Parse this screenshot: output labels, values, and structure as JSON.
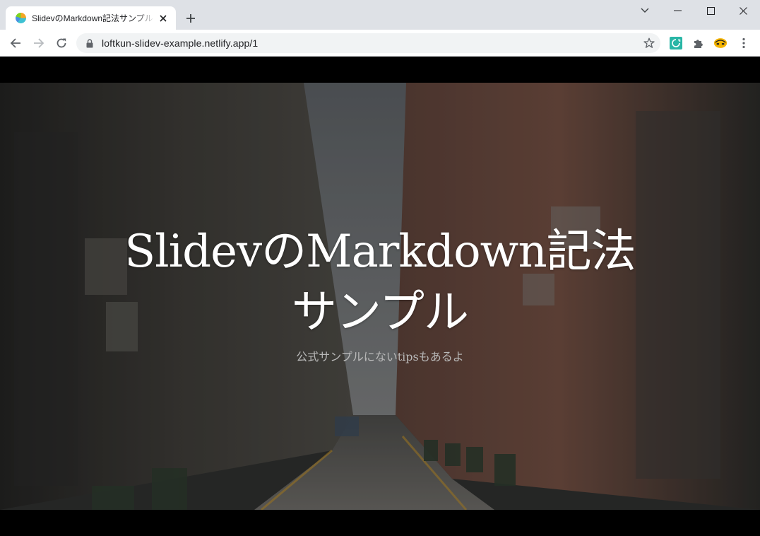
{
  "browser": {
    "tab": {
      "title": "SlidevのMarkdown記法サンプル - Slidev"
    },
    "address": {
      "url": "loftkun-slidev-example.netlify.app/1"
    }
  },
  "slide": {
    "title_line1": "SlidevのMarkdown記法",
    "title_line2": "サンプル",
    "subtitle": "公式サンプルにないtipsもあるよ"
  },
  "icons": {
    "tab": [
      "favicon",
      "close-icon",
      "plus-icon"
    ],
    "window": [
      "chevron-down-icon",
      "minimize-icon",
      "maximize-icon",
      "close-icon"
    ],
    "toolbar": [
      "back-arrow-icon",
      "forward-arrow-icon",
      "reload-icon",
      "lock-icon",
      "star-icon",
      "extension-icon",
      "puzzle-icon",
      "profile-avatar-icon",
      "kebab-menu-icon"
    ]
  },
  "colors": {
    "titlebar": "#dee1e6",
    "toolbar": "#ffffff",
    "omnibox": "#f1f3f4",
    "slide_text": "#ffffff",
    "subtitle_text": "#b9b9b9"
  }
}
